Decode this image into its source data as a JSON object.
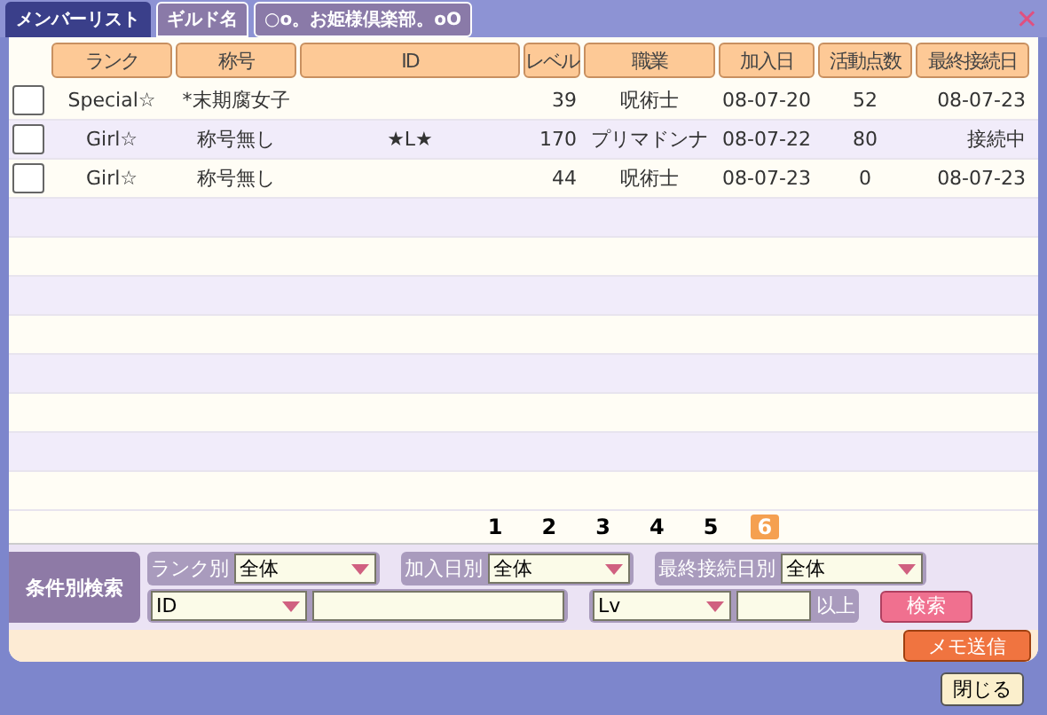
{
  "tabs": [
    {
      "label": "メンバーリスト",
      "selected": true
    },
    {
      "label": "ギルド名",
      "selected": false
    }
  ],
  "guild_name": "○o。お姫様倶楽部。oO",
  "close_icon": "✕",
  "table": {
    "columns": [
      "ランク",
      "称号",
      "ID",
      "レベル",
      "職業",
      "加入日",
      "活動点数",
      "最終接続日"
    ],
    "rows": [
      {
        "checked": false,
        "cells": [
          "Special☆",
          "*末期腐女子",
          "",
          "39",
          "呪術士",
          "08-07-20",
          "52",
          "08-07-23"
        ]
      },
      {
        "checked": false,
        "cells": [
          "Girl☆",
          "称号無し",
          "★L★",
          "170",
          "プリマドンナ",
          "08-07-22",
          "80",
          "接続中"
        ]
      },
      {
        "checked": false,
        "cells": [
          "Girl☆",
          "称号無し",
          "",
          "44",
          "呪術士",
          "08-07-23",
          "0",
          "08-07-23"
        ]
      }
    ]
  },
  "pages": [
    {
      "label": "1",
      "selected": false
    },
    {
      "label": "2",
      "selected": false
    },
    {
      "label": "3",
      "selected": false
    },
    {
      "label": "4",
      "selected": false
    },
    {
      "label": "5",
      "selected": false
    },
    {
      "label": "6",
      "selected": true
    }
  ],
  "search": {
    "title": "条件別検索",
    "filters": [
      {
        "label": "ランク別",
        "value": "全体"
      },
      {
        "label": "加入日別",
        "value": "全体"
      },
      {
        "label": "最終接続日別",
        "value": "全体"
      }
    ],
    "id_select": "ID",
    "lv_select": "Lv",
    "min_label": "以上",
    "search_button": "検索"
  },
  "memo_button": "メモ送信",
  "close_button": "閉じる"
}
